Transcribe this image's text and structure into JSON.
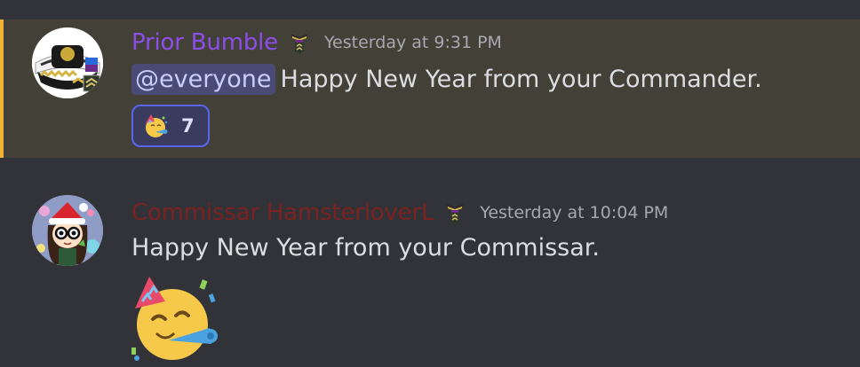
{
  "messages": [
    {
      "username": "Prior Bumble",
      "username_color": "#8c4ee8",
      "timestamp": "Yesterday at 9:31 PM",
      "mention": "@everyone",
      "text": "Happy New Year from your Commander.",
      "reaction": {
        "emoji": "partying-face",
        "count": "7"
      },
      "highlight_color": "#f0b232",
      "avatar": "naval-officer-cap"
    },
    {
      "username": "Commissar HamsterloverL",
      "username_color": "#7a2222",
      "timestamp": "Yesterday at 10:04 PM",
      "text": "Happy New Year from your Commissar.",
      "big_emoji": "partying-face",
      "avatar": "cartoon-santa-hat-character"
    }
  ],
  "colors": {
    "background": "#313338",
    "highlight_background": "#434038",
    "mention_background": "#5865f2",
    "text": "#dbdee1",
    "timestamp": "#a7a9b0"
  }
}
